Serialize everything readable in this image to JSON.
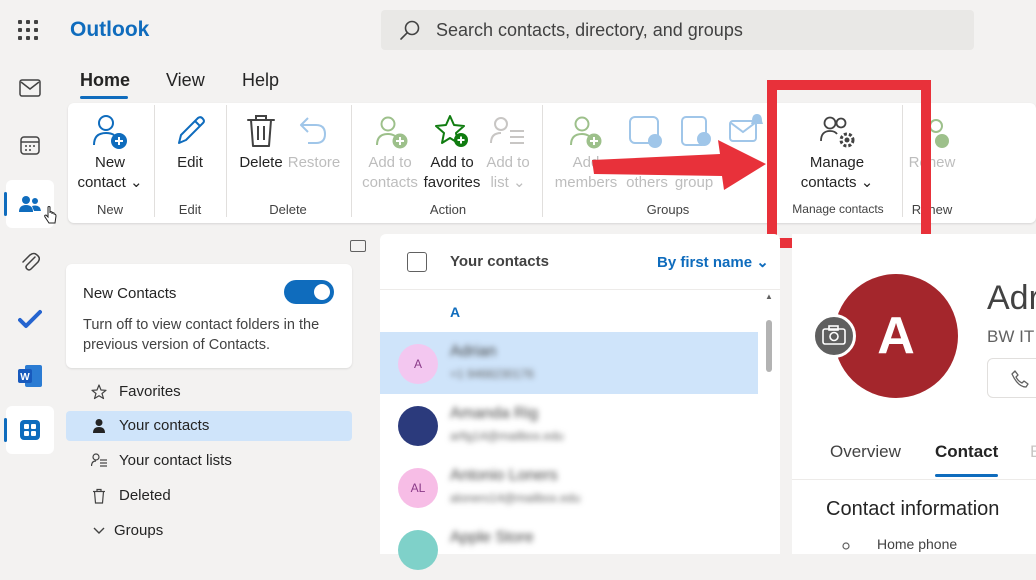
{
  "app": {
    "title": "Outlook"
  },
  "search": {
    "placeholder": "Search contacts, directory, and groups"
  },
  "rail": [
    "mail-icon",
    "calendar-icon",
    "people-icon",
    "attachment-icon",
    "todo-icon",
    "word-icon",
    "apps-icon"
  ],
  "ribbon": {
    "tabs": [
      "Home",
      "View",
      "Help"
    ],
    "active_tab": "Home",
    "items": {
      "new_contact": [
        "New",
        "contact"
      ],
      "edit": "Edit",
      "delete": "Delete",
      "restore": "Restore",
      "add_to_contacts": [
        "Add to",
        "contacts"
      ],
      "add_to_favorites": [
        "Add to",
        "favorites"
      ],
      "add_to_list": [
        "Add to",
        "list"
      ],
      "add_members": [
        "Add",
        "members"
      ],
      "others": "others",
      "group": "group",
      "manage_contacts": [
        "Manage",
        "contacts"
      ],
      "renew": "Renew"
    },
    "groups": {
      "new": "New",
      "edit": "Edit",
      "delete": "Delete",
      "action": "Action",
      "groups": "Groups",
      "manage_contacts": "Manage contacts",
      "renew": "Renew"
    }
  },
  "left_panel": {
    "new_contacts": {
      "title": "New Contacts",
      "description": "Turn off to view contact folders in the previous version of Contacts.",
      "enabled": true
    },
    "nav": [
      {
        "label": "Favorites",
        "icon": "star-icon"
      },
      {
        "label": "Your contacts",
        "icon": "person-icon",
        "active": true
      },
      {
        "label": "Your contact lists",
        "icon": "contact-list-icon"
      },
      {
        "label": "Deleted",
        "icon": "trash-icon"
      },
      {
        "label": "Groups",
        "icon": "chevron-down-icon"
      }
    ]
  },
  "contact_list": {
    "title": "Your contacts",
    "sort": "By first name",
    "section_letter": "A",
    "contacts": [
      {
        "name": "Adrian",
        "sub": "+1 9468230176",
        "initials": "A",
        "color": "#f3c7f0"
      },
      {
        "name": "Amanda Rig",
        "sub": "arfig14@mailbox.edu",
        "initials": "",
        "color": "#2b3a7c"
      },
      {
        "name": "Antonio Loners",
        "sub": "alonero14@mailbox.edu",
        "initials": "AL",
        "color": "#f7bde6"
      },
      {
        "name": "Apple Store",
        "sub": "",
        "initials": "",
        "color": "#7fd1c9"
      }
    ]
  },
  "detail": {
    "avatar_letter": "A",
    "avatar_color": "#a4262c",
    "name": "Adr",
    "company": "BW IT",
    "tabs": [
      "Overview",
      "Contact",
      "E"
    ],
    "active_tab": "Contact",
    "section_title": "Contact information",
    "home_phone_label": "Home phone"
  },
  "colors": {
    "accent": "#0f6cbd",
    "highlight": "#e8313a"
  }
}
